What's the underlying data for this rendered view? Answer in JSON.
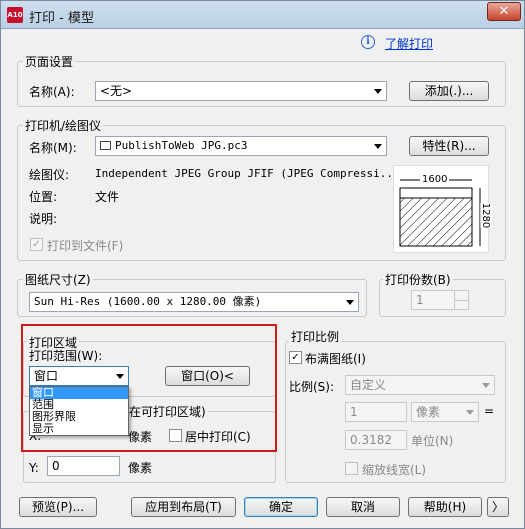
{
  "window": {
    "app_icon_text": "A10",
    "title": "打印 - 模型",
    "close_glyph": "✕"
  },
  "help": {
    "info_glyph": "i",
    "link": "了解打印"
  },
  "page_setup": {
    "legend": "页面设置",
    "name_label": "名称(A):",
    "name_value": "<无>",
    "add_button": "添加(.)..."
  },
  "printer": {
    "legend": "打印机/绘图仪",
    "name_label": "名称(M):",
    "name_value": "PublishToWeb JPG.pc3",
    "properties_button": "特性(R)...",
    "plotter_label": "绘图仪:",
    "plotter_value": "Independent JPEG Group JFIF (JPEG Compressi...",
    "location_label": "位置:",
    "location_value": "文件",
    "description_label": "说明:",
    "print_to_file_label": "打印到文件(F)",
    "print_to_file_checked": true,
    "preview_width": "1600",
    "preview_height": "1280"
  },
  "paper_size": {
    "legend": "图纸尺寸(Z)",
    "value": "Sun Hi-Res (1600.00 x 1280.00 像素)"
  },
  "copies": {
    "legend": "打印份数(B)",
    "value": "1"
  },
  "plot_area": {
    "legend": "打印区域",
    "range_label": "打印范围(W):",
    "range_value": "窗口",
    "window_button": "窗口(O)<",
    "dropdown_options": [
      "窗口",
      "范围",
      "图形界限",
      "显示"
    ],
    "dropdown_selected_index": 0
  },
  "plot_offset": {
    "legend": "在可打印区域)",
    "x_label": "X:",
    "x_unit": "像素",
    "y_label": "Y:",
    "y_value": "0",
    "y_unit": "像素",
    "center_label": "居中打印(C)",
    "center_checked": false
  },
  "plot_scale": {
    "legend": "打印比例",
    "fit_label": "布满图纸(I)",
    "fit_checked": true,
    "scale_label": "比例(S):",
    "scale_value": "自定义",
    "value1": "1",
    "unit1": "像素",
    "equals": "=",
    "value2": "0.3182",
    "unit2": "单位(N)",
    "lineweights_label": "缩放线宽(L)",
    "lineweights_checked": false
  },
  "footer": {
    "preview_button": "预览(P)...",
    "apply_button": "应用到布局(T)",
    "ok_button": "确定",
    "cancel_button": "取消",
    "help_button": "帮助(H)",
    "more_glyph": "〉"
  },
  "colors": {
    "highlight_box": "#c81e1e",
    "selection": "#3399ff",
    "link": "#0033cc"
  }
}
